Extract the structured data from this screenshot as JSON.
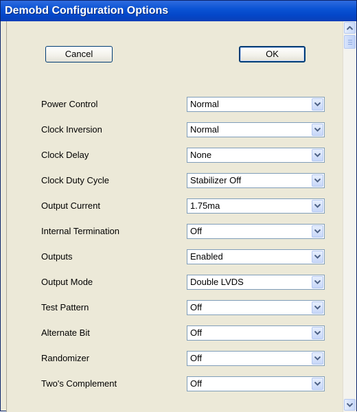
{
  "window": {
    "title": "Demobd Configuration Options"
  },
  "buttons": {
    "cancel": "Cancel",
    "ok": "OK"
  },
  "options": [
    {
      "label": "Power Control",
      "value": "Normal"
    },
    {
      "label": "Clock Inversion",
      "value": "Normal"
    },
    {
      "label": "Clock Delay",
      "value": "None"
    },
    {
      "label": "Clock Duty Cycle",
      "value": "Stabilizer Off"
    },
    {
      "label": "Output Current",
      "value": "1.75ma"
    },
    {
      "label": "Internal Termination",
      "value": "Off"
    },
    {
      "label": "Outputs",
      "value": "Enabled"
    },
    {
      "label": "Output Mode",
      "value": "Double LVDS"
    },
    {
      "label": "Test Pattern",
      "value": "Off"
    },
    {
      "label": "Alternate Bit",
      "value": "Off"
    },
    {
      "label": "Randomizer",
      "value": "Off"
    },
    {
      "label": "Two's Complement",
      "value": "Off"
    }
  ],
  "scrollbar": {
    "position": 0.0
  }
}
